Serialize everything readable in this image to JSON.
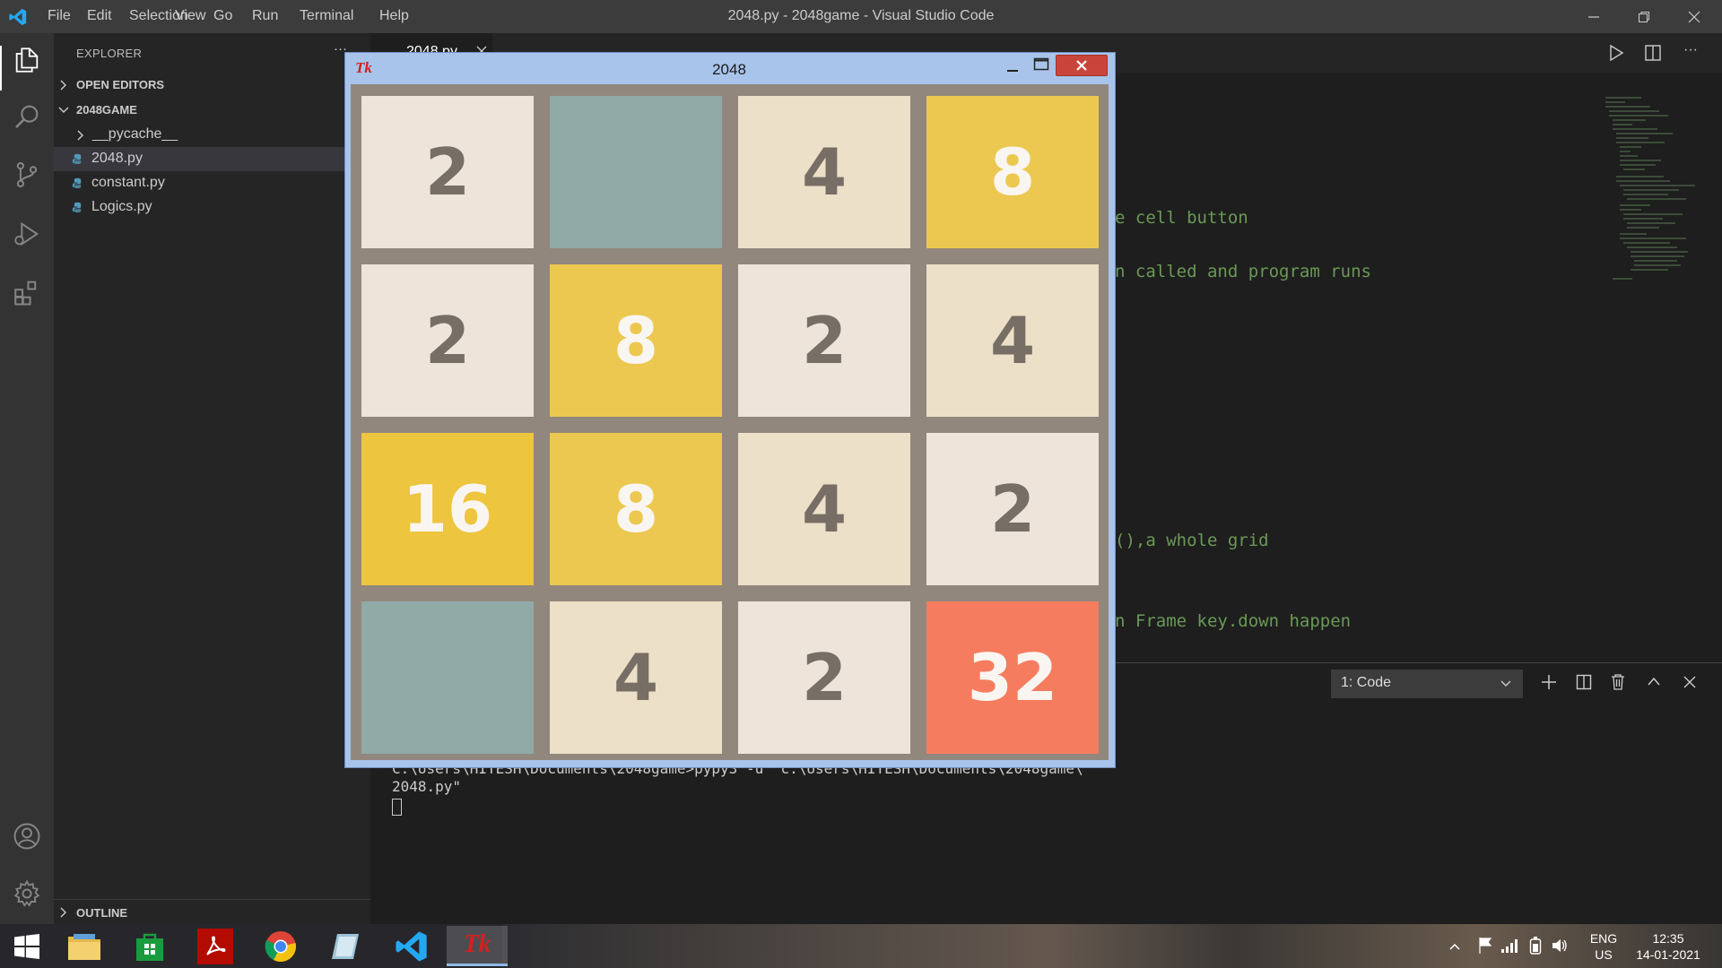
{
  "window": {
    "title": "2048.py - 2048game - Visual Studio Code"
  },
  "menu": [
    "File",
    "Edit",
    "Selection",
    "View",
    "Go",
    "Run",
    "Terminal",
    "Help"
  ],
  "sidebar": {
    "title": "EXPLORER",
    "more": "···",
    "open_editors": "OPEN EDITORS",
    "folder": "2048GAME",
    "items": [
      {
        "label": "__pycache__",
        "type": "folder"
      },
      {
        "label": "2048.py",
        "type": "python",
        "selected": true
      },
      {
        "label": "constant.py",
        "type": "python"
      },
      {
        "label": "Logics.py",
        "type": "python"
      }
    ],
    "outline": "OUTLINE"
  },
  "editor": {
    "tab_label": "2048.py",
    "visible_code_fragments": [
      "e cell button",
      "n called and program runs",
      "(),a whole grid",
      "n Frame key.down happen"
    ]
  },
  "panel": {
    "terminal_select": "1: Code",
    "lines": [
      "C:\\Users\\HITESH\\Documents\\2048game>pypy3 -u \"c:\\Users\\HITESH\\Documents\\2048game\\",
      "2048.py\""
    ]
  },
  "tk": {
    "title": "2048",
    "logo": "Tk",
    "grid": [
      [
        {
          "v": "2"
        },
        {
          "v": ""
        },
        {
          "v": "4"
        },
        {
          "v": "8"
        }
      ],
      [
        {
          "v": "2"
        },
        {
          "v": "8"
        },
        {
          "v": "2"
        },
        {
          "v": "4"
        }
      ],
      [
        {
          "v": "16"
        },
        {
          "v": "8"
        },
        {
          "v": "4"
        },
        {
          "v": "2"
        }
      ],
      [
        {
          "v": ""
        },
        {
          "v": "4"
        },
        {
          "v": "2"
        },
        {
          "v": "32"
        }
      ]
    ],
    "colors": {
      "empty": "#90aaa6",
      "2": "#eee4da",
      "4": "#ede0c8",
      "8": "#ecc850",
      "16": "#edc53f",
      "32": "#f67c5f",
      "dark_text": "#776e65",
      "light_text": "#f9f6f2",
      "grid_bg": "#92877d"
    }
  },
  "taskbar": {
    "lang": "ENG",
    "region": "US",
    "time": "12:35",
    "date": "14-01-2021"
  },
  "accent": "#007acc"
}
